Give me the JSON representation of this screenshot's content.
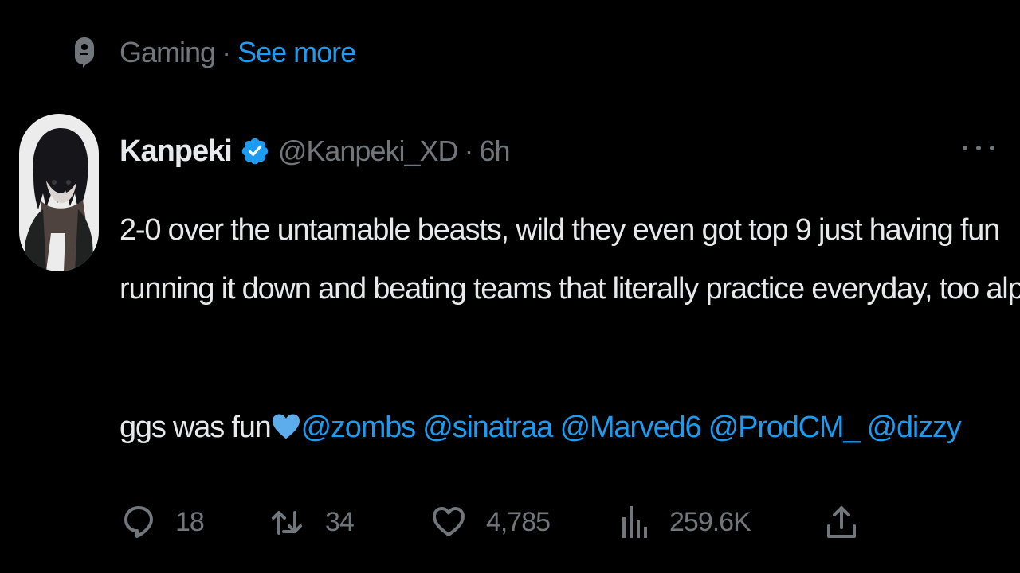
{
  "topic": {
    "name": "Gaming",
    "separator": "·",
    "see_more": "See more"
  },
  "author": {
    "display_name": "Kanpeki",
    "handle": "@Kanpeki_XD",
    "separator": "·",
    "timestamp": "6h",
    "verified": true
  },
  "tweet": {
    "line1": "2-0 over the untamable beasts, wild they even got top 9 just having fun",
    "line2": "running it down and beating teams that literally practice everyday, too alpha",
    "line3_prefix": "ggs was fun",
    "mentions": [
      "@zombs",
      "@sinatraa",
      "@Marved6",
      "@ProdCM_",
      "@dizzy"
    ]
  },
  "actions": {
    "replies": "18",
    "retweets": "34",
    "likes": "4,785",
    "views": "259.6K"
  },
  "colors": {
    "background": "#000000",
    "text": "#e7e9ea",
    "muted": "#71767b",
    "accent": "#1d9bf0"
  },
  "icons": {
    "topic": "topic-icon",
    "verified": "verified-badge-icon",
    "more": "more-icon",
    "reply": "reply-icon",
    "retweet": "retweet-icon",
    "like": "like-icon",
    "views": "views-icon",
    "share": "share-icon"
  }
}
